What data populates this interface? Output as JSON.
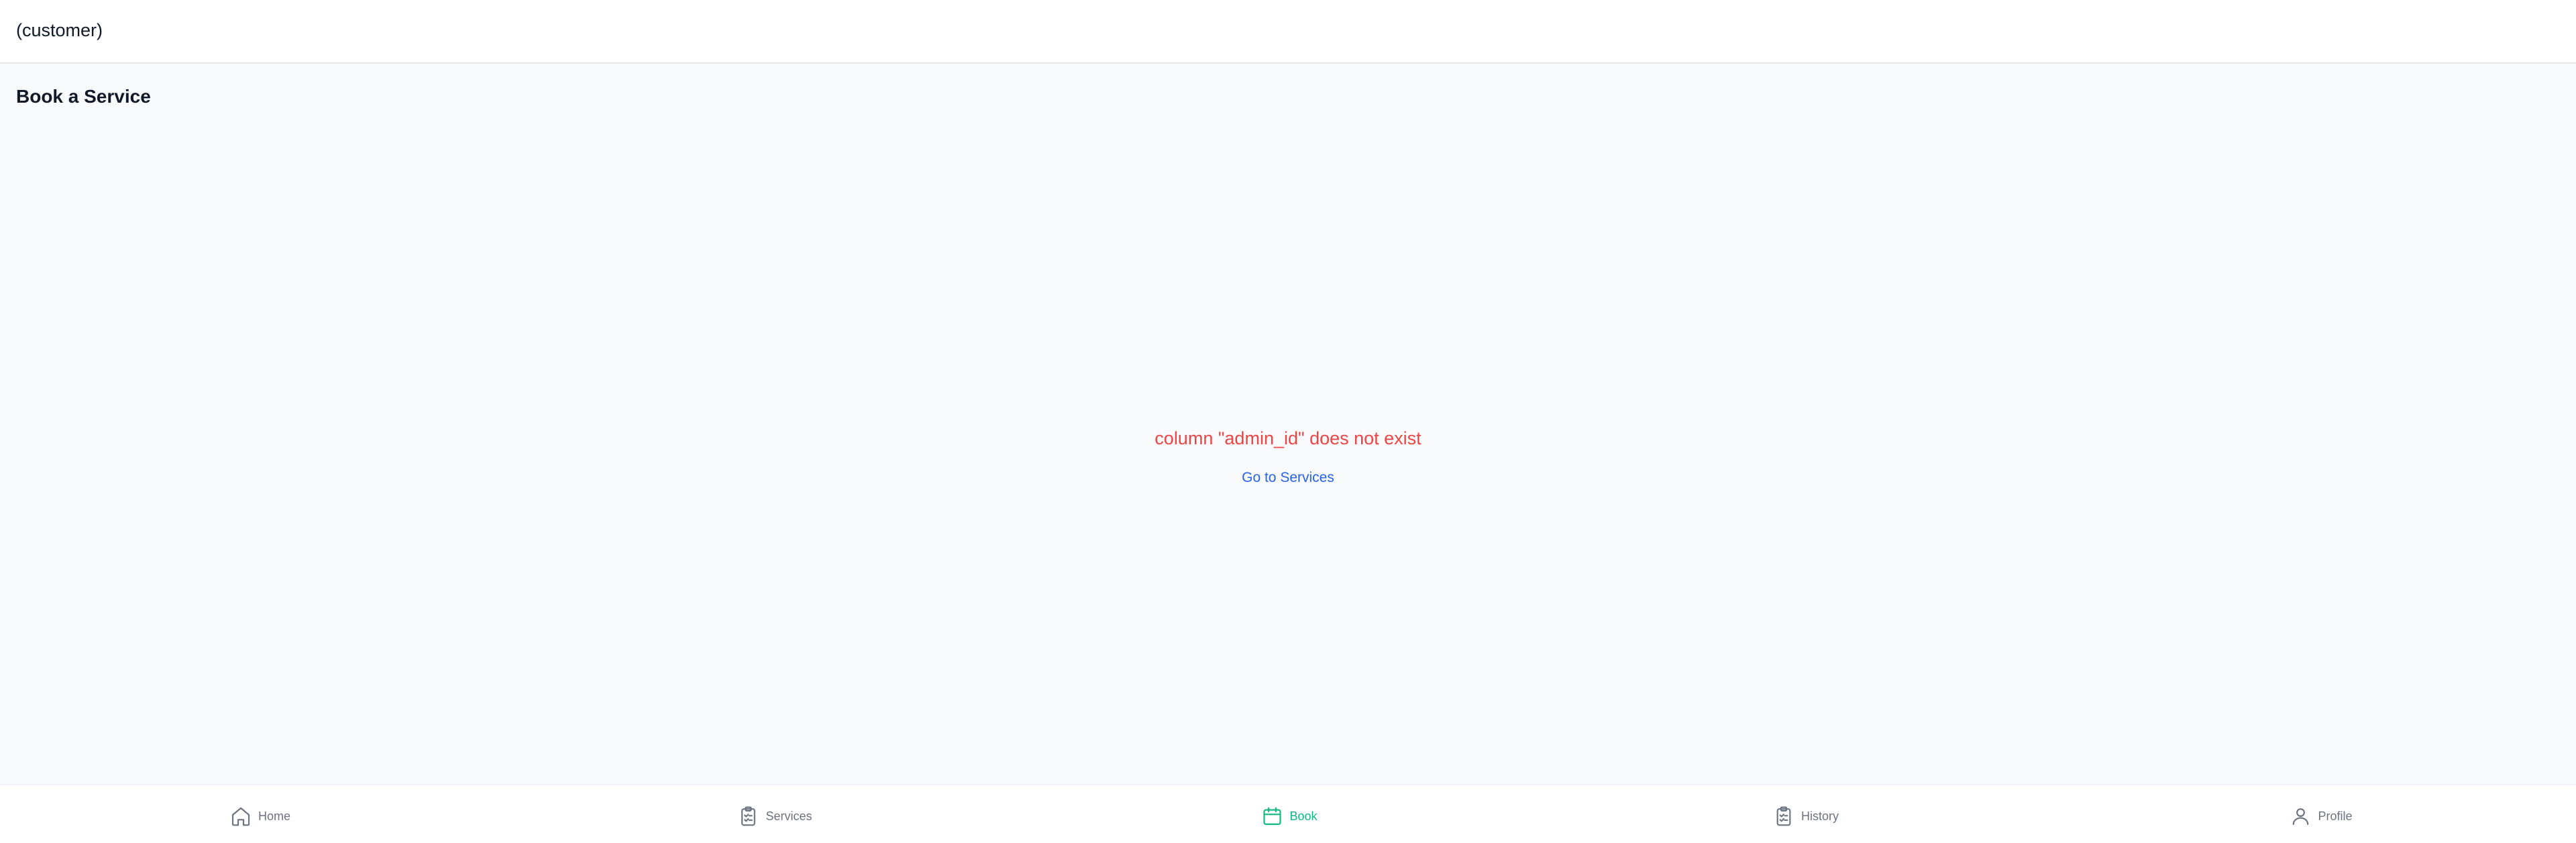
{
  "header": {
    "role_label": "(customer)"
  },
  "page": {
    "title": "Book a Service",
    "error_message": "column \"admin_id\" does not exist",
    "action_link": "Go to Services"
  },
  "nav": {
    "items": [
      {
        "label": "Home",
        "icon": "home-icon"
      },
      {
        "label": "Services",
        "icon": "clipboard-icon"
      },
      {
        "label": "Book",
        "icon": "calendar-icon",
        "active": true
      },
      {
        "label": "History",
        "icon": "clipboard-icon"
      },
      {
        "label": "Profile",
        "icon": "user-icon"
      }
    ]
  },
  "colors": {
    "active": "#10b981",
    "error": "#ef4444",
    "link": "#2563eb",
    "inactive": "#6b7280"
  }
}
